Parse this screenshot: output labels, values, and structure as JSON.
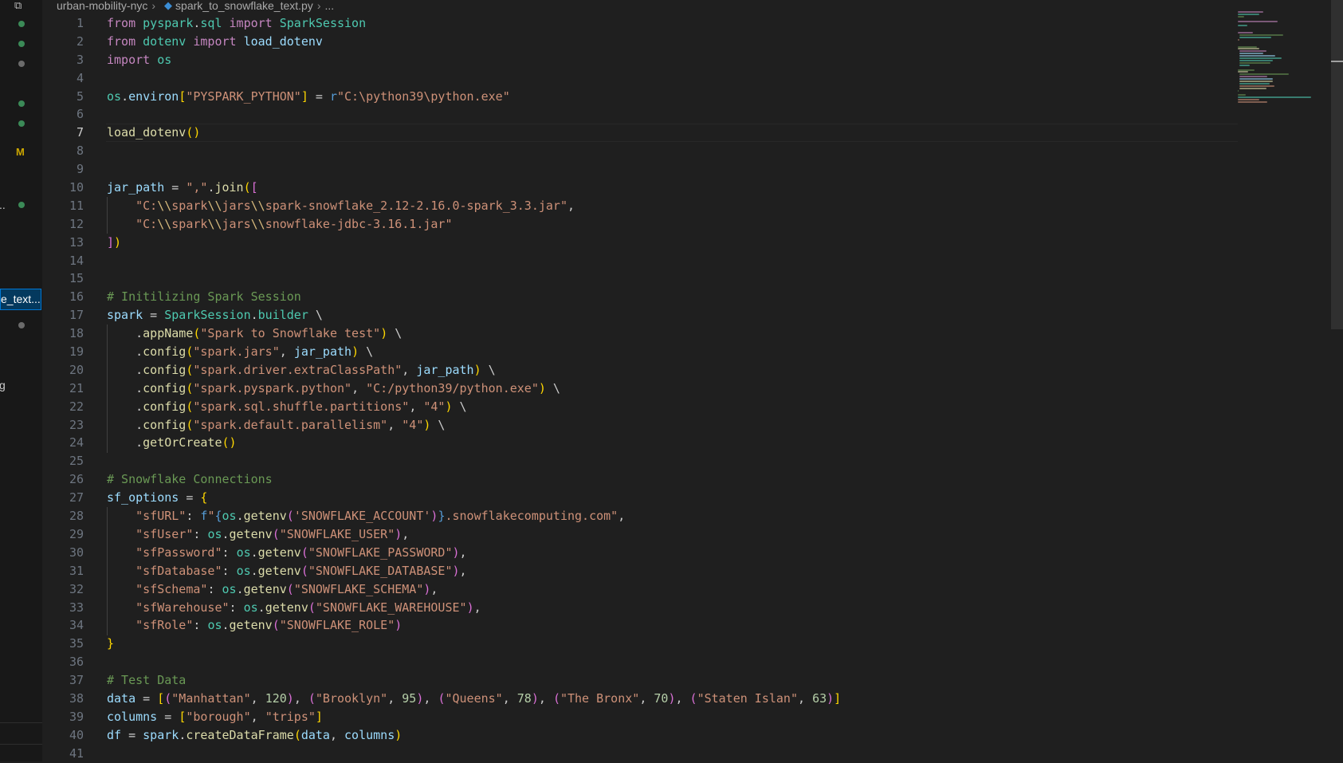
{
  "breadcrumb": {
    "folder": "urban-mobility-nyc",
    "file": "spark_to_snowflake_text.py",
    "ellipsis": "..."
  },
  "explorer": {
    "status_letter": "M",
    "partial_labels": [
      "..",
      "e_text...",
      "g"
    ]
  },
  "editor": {
    "active_line": 7,
    "language": "python",
    "code_lines": [
      "from pyspark.sql import SparkSession",
      "from dotenv import load_dotenv",
      "import os",
      "",
      "os.environ[\"PYSPARK_PYTHON\"] = r\"C:\\python39\\python.exe\"",
      "",
      "load_dotenv()",
      "",
      "",
      "jar_path = \",\".join([",
      "    \"C:\\\\spark\\\\jars\\\\spark-snowflake_2.12-2.16.0-spark_3.3.jar\",",
      "    \"C:\\\\spark\\\\jars\\\\snowflake-jdbc-3.16.1.jar\"",
      "])",
      "",
      "",
      "# Initilizing Spark Session",
      "spark = SparkSession.builder \\",
      "    .appName(\"Spark to Snowflake test\") \\",
      "    .config(\"spark.jars\", jar_path) \\",
      "    .config(\"spark.driver.extraClassPath\", jar_path) \\",
      "    .config(\"spark.pyspark.python\", \"C:/python39/python.exe\") \\",
      "    .config(\"spark.sql.shuffle.partitions\", \"4\") \\",
      "    .config(\"spark.default.parallelism\", \"4\") \\",
      "    .getOrCreate()",
      "",
      "# Snowflake Connections",
      "sf_options = {",
      "    \"sfURL\": f\"{os.getenv('SNOWFLAKE_ACCOUNT')}.snowflakecomputing.com\",",
      "    \"sfUser\": os.getenv(\"SNOWFLAKE_USER\"),",
      "    \"sfPassword\": os.getenv(\"SNOWFLAKE_PASSWORD\"),",
      "    \"sfDatabase\": os.getenv(\"SNOWFLAKE_DATABASE\"),",
      "    \"sfSchema\": os.getenv(\"SNOWFLAKE_SCHEMA\"),",
      "    \"sfWarehouse\": os.getenv(\"SNOWFLAKE_WAREHOUSE\"),",
      "    \"sfRole\": os.getenv(\"SNOWFLAKE_ROLE\")",
      "}",
      "",
      "# Test Data",
      "data = [(\"Manhattan\", 120), (\"Brooklyn\", 95), (\"Queens\", 78), (\"The Bronx\", 70), (\"Staten Islan\", 63)]",
      "columns = [\"borough\", \"trips\"]",
      "df = spark.createDataFrame(data, columns)",
      ""
    ]
  },
  "colors": {
    "keyword": "#c586c0",
    "module": "#4ec9b0",
    "function": "#dcdcaa",
    "variable": "#9cdcfe",
    "string": "#ce9178",
    "comment": "#6a9955",
    "number": "#b5cea8",
    "bracket1": "#ffd700",
    "bracket2": "#da70d6",
    "bracket3": "#179fff",
    "background": "#1f1f1f",
    "git_added": "#3b8a57",
    "git_modified": "#cca700"
  },
  "icons": {
    "explorer_header": "copy-icon",
    "breadcrumb_file": "python-file-icon",
    "chevron": "chevron-right-icon"
  }
}
